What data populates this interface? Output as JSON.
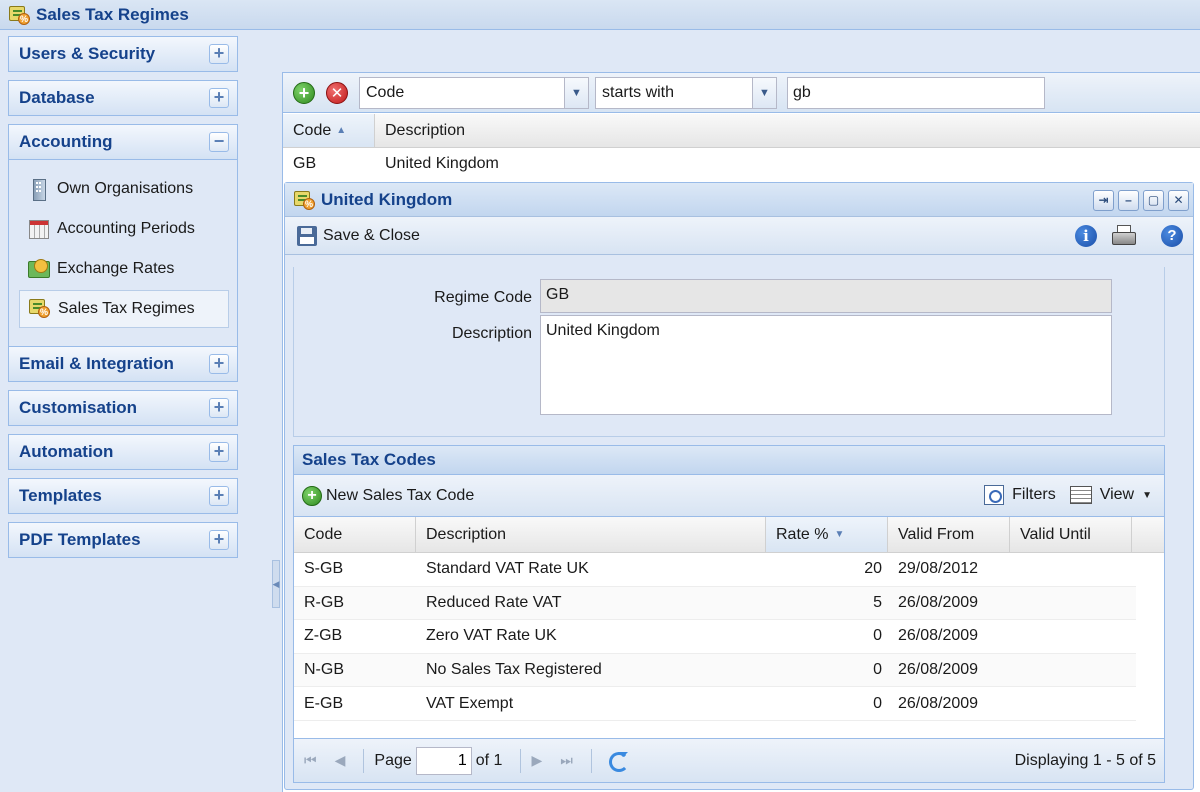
{
  "app": {
    "title": "Sales Tax Regimes"
  },
  "sidebar": {
    "sections": [
      {
        "label": "Users & Security",
        "tool": "+"
      },
      {
        "label": "Database",
        "tool": "+"
      },
      {
        "label": "Accounting",
        "tool": "−"
      },
      {
        "label": "Email & Integration",
        "tool": "+"
      },
      {
        "label": "Customisation",
        "tool": "+"
      },
      {
        "label": "Automation",
        "tool": "+"
      },
      {
        "label": "Templates",
        "tool": "+"
      },
      {
        "label": "PDF Templates",
        "tool": "+"
      }
    ],
    "accounting_items": [
      {
        "label": "Own Organisations",
        "icon": "building-icon"
      },
      {
        "label": "Accounting Periods",
        "icon": "calendar-icon"
      },
      {
        "label": "Exchange Rates",
        "icon": "exchange-rates-icon"
      },
      {
        "label": "Sales Tax Regimes",
        "icon": "sales-tax-icon",
        "active": true
      }
    ]
  },
  "filter": {
    "field": "Code",
    "operator": "starts with",
    "value": "gb"
  },
  "list_grid": {
    "columns": [
      "Code",
      "Description"
    ],
    "rows": [
      {
        "code": "GB",
        "description": "United Kingdom"
      }
    ]
  },
  "window": {
    "title": "United Kingdom",
    "save_close": "Save & Close",
    "tools": [
      "⇥",
      "–",
      "▢",
      "✕"
    ],
    "form": {
      "regime_code_label": "Regime Code",
      "regime_code_value": "GB",
      "description_label": "Description",
      "description_value": "United Kingdom"
    },
    "tax_codes": {
      "title": "Sales Tax Codes",
      "new_label": "New Sales Tax Code",
      "filters_label": "Filters",
      "view_label": "View",
      "columns": [
        "Code",
        "Description",
        "Rate %",
        "Valid From",
        "Valid Until"
      ],
      "rows": [
        {
          "code": "S-GB",
          "description": "Standard VAT Rate UK",
          "rate": "20",
          "valid_from": "29/08/2012",
          "valid_until": ""
        },
        {
          "code": "R-GB",
          "description": "Reduced Rate VAT",
          "rate": "5",
          "valid_from": "26/08/2009",
          "valid_until": ""
        },
        {
          "code": "Z-GB",
          "description": "Zero VAT Rate UK",
          "rate": "0",
          "valid_from": "26/08/2009",
          "valid_until": ""
        },
        {
          "code": "N-GB",
          "description": "No Sales Tax Registered",
          "rate": "0",
          "valid_from": "26/08/2009",
          "valid_until": ""
        },
        {
          "code": "E-GB",
          "description": "VAT Exempt",
          "rate": "0",
          "valid_from": "26/08/2009",
          "valid_until": ""
        }
      ]
    },
    "pager": {
      "page_label": "Page",
      "page_value": "1",
      "of_label": "of 1",
      "display": "Displaying 1 - 5 of 5"
    }
  }
}
